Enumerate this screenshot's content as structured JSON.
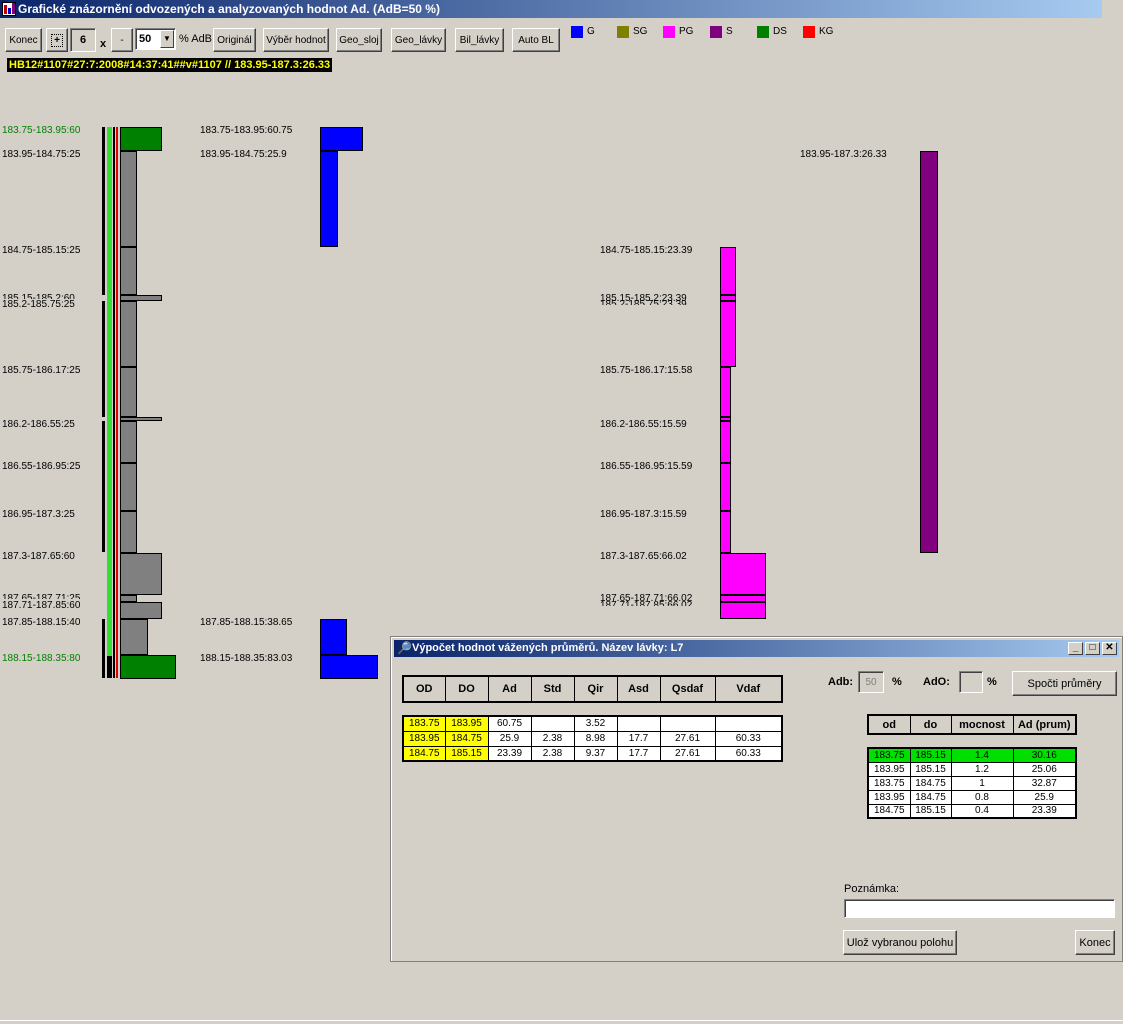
{
  "window": {
    "title": "Grafické znázornění odvozených a analyzovaných hodnot Ad.  (AdB=50 %)"
  },
  "toolbar": {
    "konec_label": "Konec",
    "plus_label": "+",
    "value": "6",
    "x_label": "x",
    "minus_label": "-",
    "percent_select": "50",
    "adb_label": "% AdB",
    "original_label": "Originál",
    "vyber_label": "Výběr hodnot",
    "geo_sloj_label": "Geo_sloj",
    "geo_lavky_label": "Geo_lávky",
    "bil_lavky_label": "Bil_lávky",
    "auto_bl_label": "Auto BL"
  },
  "legend": [
    {
      "label": "G",
      "color": "#0000ff"
    },
    {
      "label": "SG",
      "color": "#808000"
    },
    {
      "label": "PG",
      "color": "#ff00ff"
    },
    {
      "label": "S",
      "color": "#800080"
    },
    {
      "label": "DS",
      "color": "#008000"
    },
    {
      "label": "KG",
      "color": "#ff0000"
    }
  ],
  "info_line": "HB12#1107#27:7:2008#14:37:41##v#1107 // 183.95-187.3:26.33",
  "left_labels": [
    {
      "text": "183.75-183.95:60",
      "color": "#008000"
    },
    {
      "text": "183.95-184.75:25",
      "color": "#000000"
    },
    {
      "text": "184.75-185.15:25",
      "color": "#000000"
    },
    {
      "text": "185.15-185.2:60",
      "color": "#000000"
    },
    {
      "text": "185.2-185.75:25",
      "color": "#000000"
    },
    {
      "text": "185.75-186.17:25",
      "color": "#000000"
    },
    {
      "text": "186.2-186.55:25",
      "color": "#000000"
    },
    {
      "text": "186.55-186.95:25",
      "color": "#000000"
    },
    {
      "text": "186.95-187.3:25",
      "color": "#000000"
    },
    {
      "text": "187.3-187.65:60",
      "color": "#000000"
    },
    {
      "text": "187.65-187.71:25",
      "color": "#000000"
    },
    {
      "text": "187.71-187.85:60",
      "color": "#000000"
    },
    {
      "text": "187.85-188.15:40",
      "color": "#000000"
    },
    {
      "text": "188.15-188.35:80",
      "color": "#008000"
    }
  ],
  "blue_labels": [
    "183.75-183.95:60.75",
    "183.95-184.75:25.9",
    "187.85-188.15:38.65",
    "188.15-188.35:83.03"
  ],
  "pg_labels": [
    "184.75-185.15:23.39",
    "185.15-185.2:23.39",
    "185.2-185.75:23.39",
    "185.75-186.17:15.58",
    "186.2-186.55:15.59",
    "186.55-186.95:15.59",
    "186.95-187.3:15.59",
    "187.3-187.65:66.02",
    "187.65-187.71:66.02",
    "187.71-187.85:66.02"
  ],
  "s_label": "183.95-187.3:26.33",
  "dialog": {
    "title": "Výpočet hodnot vážených průměrů. Název lávky:  L7",
    "headers": [
      "OD",
      "DO",
      "Ad",
      "Std",
      "Qir",
      "Asd",
      "Qsdaf",
      "Vdaf"
    ],
    "rows": [
      [
        "183.75",
        "183.95",
        "60.75",
        "",
        "3.52",
        "",
        "",
        ""
      ],
      [
        "183.95",
        "184.75",
        "25.9",
        "2.38",
        "8.98",
        "17.7",
        "27.61",
        "60.33"
      ],
      [
        "184.75",
        "185.15",
        "23.39",
        "2.38",
        "9.37",
        "17.7",
        "27.61",
        "60.33"
      ]
    ],
    "adb_label": "Adb:",
    "adb_value": "50",
    "pct1": "%",
    "ad0_label": "AdO:",
    "ad0_value": "",
    "pct2": "%",
    "compute_button": "Spočti průměry",
    "avg_headers": [
      "od",
      "do",
      "mocnost",
      "Ad (prum)"
    ],
    "avg_rows": [
      [
        "183.75",
        "185.15",
        "1.4",
        "30.16"
      ],
      [
        "183.95",
        "185.15",
        "1.2",
        "25.06"
      ],
      [
        "183.75",
        "184.75",
        "1",
        "32.87"
      ],
      [
        "183.95",
        "184.75",
        "0.8",
        "25.9"
      ],
      [
        "184.75",
        "185.15",
        "0.4",
        "23.39"
      ]
    ],
    "note_label": "Poznámka:",
    "note_value": "",
    "save_button": "Ulož vybranou polohu",
    "close_button": "Konec"
  }
}
